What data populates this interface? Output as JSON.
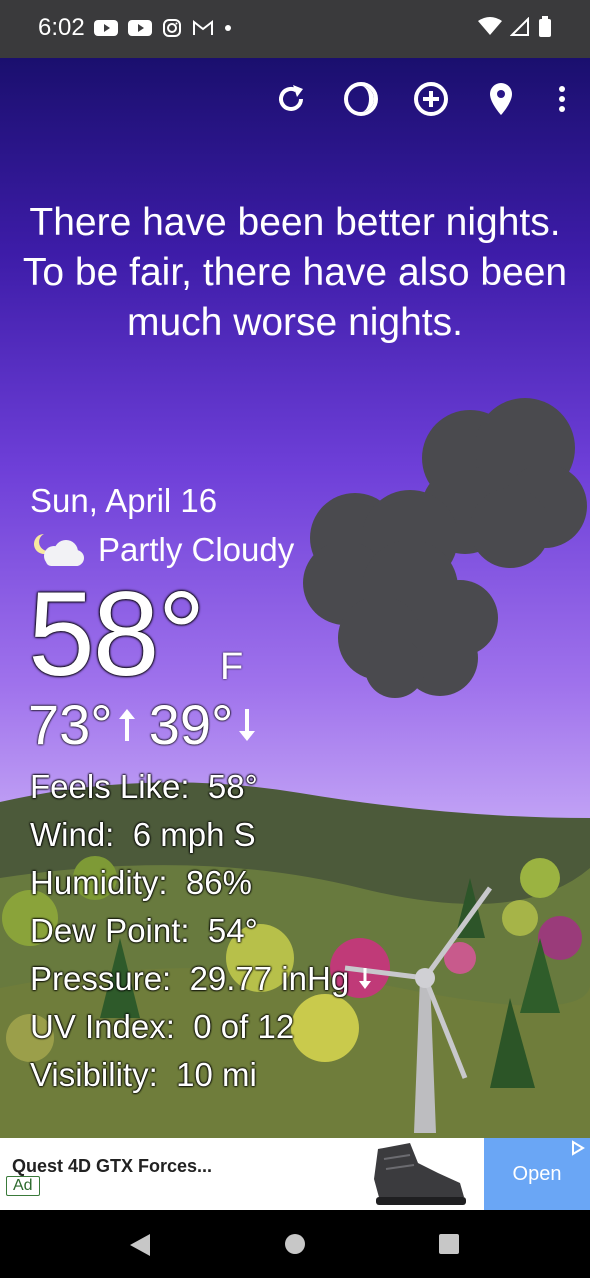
{
  "status_bar": {
    "time": "6:02"
  },
  "toolbar": {
    "buttons": [
      {
        "name": "refresh-icon"
      },
      {
        "name": "moon-phase-icon"
      },
      {
        "name": "add-location-icon"
      },
      {
        "name": "location-pin-icon"
      },
      {
        "name": "more-options-icon"
      }
    ]
  },
  "message": "There have been better nights. To be fair, there have also been much worse nights.",
  "weather": {
    "date": "Sun, April 16",
    "condition": "Partly Cloudy",
    "temperature": "58°",
    "unit": "F",
    "high": "73°",
    "low": "39°",
    "details": [
      {
        "label": "Feels Like:",
        "value": "58°"
      },
      {
        "label": "Wind:",
        "value": "6 mph S"
      },
      {
        "label": "Humidity:",
        "value": "86%"
      },
      {
        "label": "Dew Point:",
        "value": "54°"
      },
      {
        "label": "Pressure:",
        "value": "29.77 inHg"
      },
      {
        "label": "UV Index:",
        "value": "0 of 12"
      },
      {
        "label": "Visibility:",
        "value": "10 mi"
      }
    ]
  },
  "ad": {
    "title": "Quest 4D GTX Forces...",
    "badge": "Ad",
    "cta": "Open"
  }
}
